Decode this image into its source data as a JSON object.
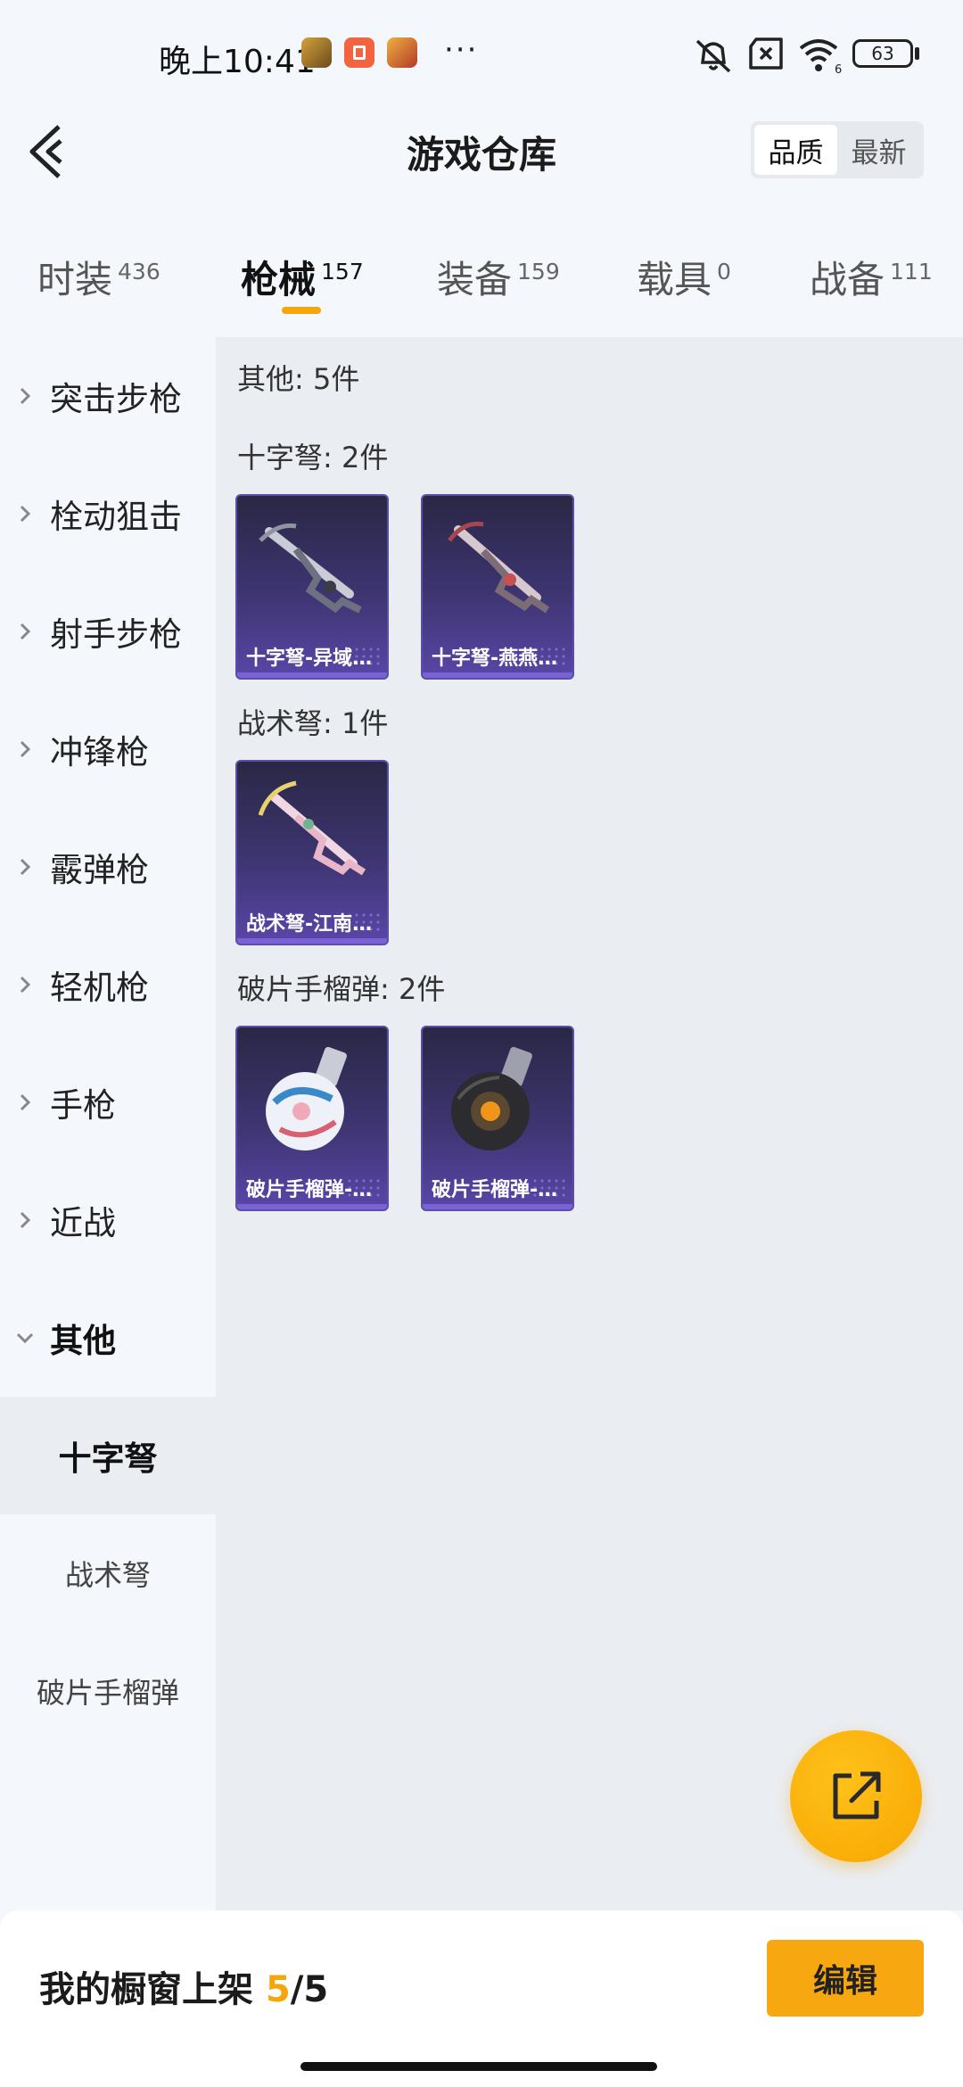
{
  "status_bar": {
    "time": "晚上10:41",
    "battery": "63",
    "wifi_label": "6"
  },
  "header": {
    "title": "游戏仓库",
    "sort_options": [
      "品质",
      "最新"
    ],
    "sort_selected": "品质"
  },
  "tabs": [
    {
      "label": "时装",
      "count": "436"
    },
    {
      "label": "枪械",
      "count": "157"
    },
    {
      "label": "装备",
      "count": "159"
    },
    {
      "label": "载具",
      "count": "0"
    },
    {
      "label": "战备",
      "count": "111"
    }
  ],
  "sidebar": {
    "categories": [
      "突击步枪",
      "栓动狙击",
      "射手步枪",
      "冲锋枪",
      "霰弹枪",
      "轻机枪",
      "手枪",
      "近战",
      "其他"
    ],
    "open_category": "其他",
    "subcategories": [
      "十字弩",
      "战术弩",
      "破片手榴弹"
    ],
    "active_subcategory": "十字弩"
  },
  "content": {
    "summary": "其他: 5件",
    "sections": [
      {
        "title": "十字弩: 2件",
        "items": [
          {
            "name": "十字弩-异域…"
          },
          {
            "name": "十字弩-燕燕…"
          }
        ]
      },
      {
        "title": "战术弩: 1件",
        "items": [
          {
            "name": "战术弩-江南…"
          }
        ]
      },
      {
        "title": "破片手榴弹: 2件",
        "items": [
          {
            "name": "破片手榴弹-…"
          },
          {
            "name": "破片手榴弹-…"
          }
        ]
      }
    ]
  },
  "fab": {
    "icon": "share-export-icon"
  },
  "bottom": {
    "label": "我的橱窗上架",
    "count": "5",
    "sep": "/",
    "total": "5",
    "edit": "编辑"
  },
  "colors": {
    "accent": "#f5a60b",
    "card_bg": "#3e3572"
  }
}
